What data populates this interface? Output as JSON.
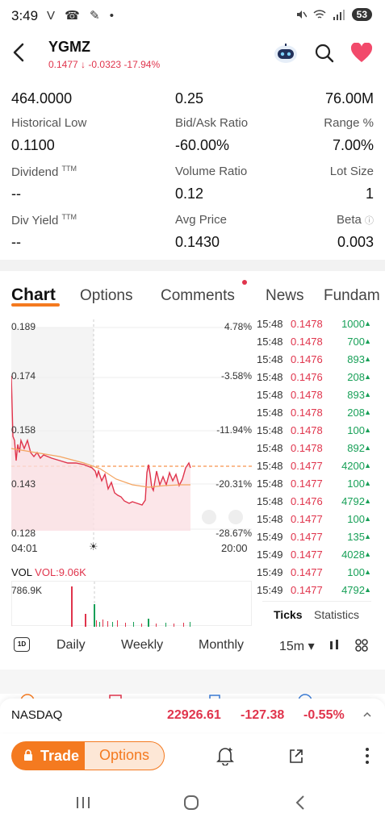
{
  "status": {
    "time": "3:49",
    "left_icons": "V ☎ ✎ •",
    "battery": "53"
  },
  "header": {
    "ticker": "YGMZ",
    "price": "0.1477",
    "change": "-0.0323",
    "change_pct": "-17.94%"
  },
  "stats": {
    "row0": {
      "c1": "464.0000",
      "c2": "0.25",
      "c3": "76.00M"
    },
    "row1": {
      "c1_label": "Historical Low",
      "c1": "0.1100",
      "c2_label": "Bid/Ask Ratio",
      "c2": "-60.00%",
      "c3_label": "Range %",
      "c3": "7.00%"
    },
    "row2": {
      "c1_label": "Dividend",
      "c1_sup": "TTM",
      "c1": "--",
      "c2_label": "Volume Ratio",
      "c2": "0.12",
      "c3_label": "Lot Size",
      "c3": "1"
    },
    "row3": {
      "c1_label": "Div Yield",
      "c1_sup": "TTM",
      "c1": "--",
      "c2_label": "Avg Price",
      "c2": "0.1430",
      "c3_label": "Beta",
      "c3": "0.003"
    }
  },
  "tabs": [
    "Chart",
    "Options",
    "Comments",
    "News",
    "Fundam"
  ],
  "chart": {
    "y_left": [
      "0.189",
      "0.174",
      "0.158",
      "0.143",
      "0.128"
    ],
    "y_right": [
      "4.78%",
      "-3.58%",
      "-11.94%",
      "-20.31%",
      "-28.67%"
    ],
    "time_start": "04:01",
    "time_end": "20:00",
    "vol_label": "VOL",
    "vol_value": "VOL:9.06K",
    "vol_max": "786.9K"
  },
  "ticks": [
    {
      "t": "15:48",
      "p": "0.1478",
      "q": "1000"
    },
    {
      "t": "15:48",
      "p": "0.1478",
      "q": "700"
    },
    {
      "t": "15:48",
      "p": "0.1476",
      "q": "893"
    },
    {
      "t": "15:48",
      "p": "0.1476",
      "q": "208"
    },
    {
      "t": "15:48",
      "p": "0.1478",
      "q": "893"
    },
    {
      "t": "15:48",
      "p": "0.1478",
      "q": "208"
    },
    {
      "t": "15:48",
      "p": "0.1478",
      "q": "100"
    },
    {
      "t": "15:48",
      "p": "0.1478",
      "q": "892"
    },
    {
      "t": "15:48",
      "p": "0.1477",
      "q": "4200"
    },
    {
      "t": "15:48",
      "p": "0.1477",
      "q": "100"
    },
    {
      "t": "15:48",
      "p": "0.1476",
      "q": "4792"
    },
    {
      "t": "15:48",
      "p": "0.1477",
      "q": "100"
    },
    {
      "t": "15:49",
      "p": "0.1477",
      "q": "135"
    },
    {
      "t": "15:49",
      "p": "0.1477",
      "q": "4028"
    },
    {
      "t": "15:49",
      "p": "0.1477",
      "q": "100"
    },
    {
      "t": "15:49",
      "p": "0.1477",
      "q": "4792"
    }
  ],
  "tick_tabs": {
    "ticks": "Ticks",
    "statistics": "Statistics"
  },
  "periods": {
    "oneD": "1D",
    "daily": "Daily",
    "weekly": "Weekly",
    "monthly": "Monthly",
    "interval": "15m ▾"
  },
  "nasdaq": {
    "name": "NASDAQ",
    "value": "22926.61",
    "change": "-127.38",
    "pct": "-0.55%"
  },
  "actions": {
    "trade": "Trade",
    "options": "Options"
  },
  "colors": {
    "accent": "#f47a20",
    "down": "#e0344c",
    "up": "#18a058"
  }
}
